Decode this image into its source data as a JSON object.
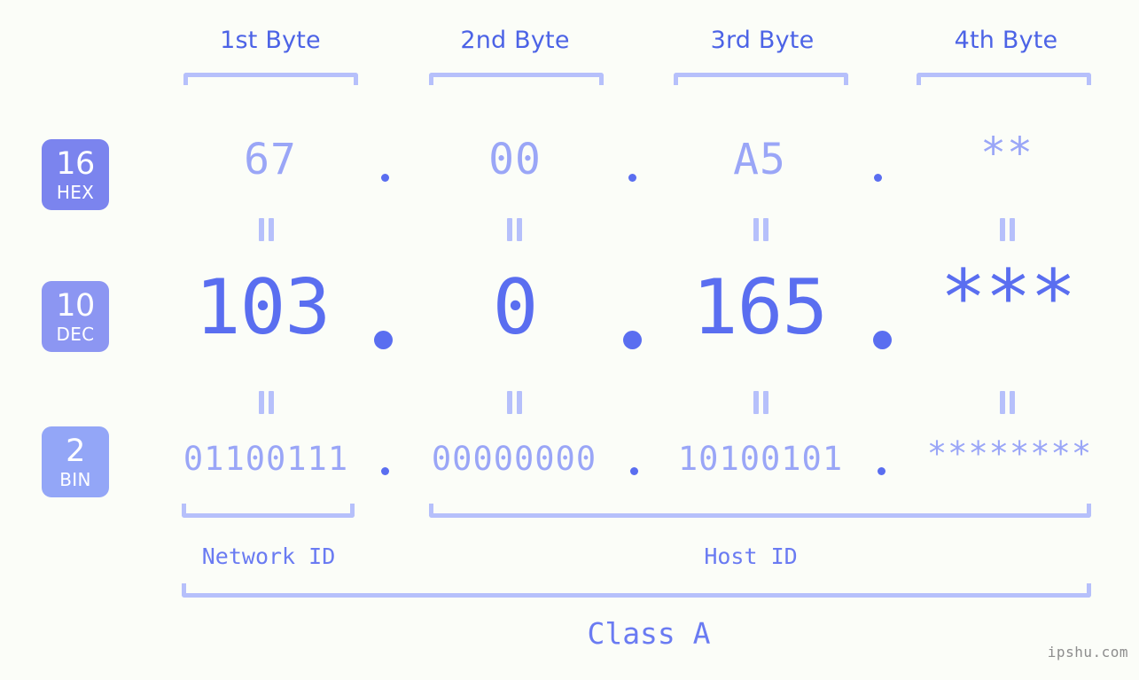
{
  "meta": {
    "watermark": "ipshu.com",
    "background_color": "#fbfdf8",
    "accent_color": "#5a6ef0",
    "light_accent_color": "#b6c0fb",
    "muted_value_color": "#9aa6f7"
  },
  "byte_headers": [
    {
      "label": "1st Byte"
    },
    {
      "label": "2nd Byte"
    },
    {
      "label": "3rd Byte"
    },
    {
      "label": "4th Byte"
    }
  ],
  "bases": [
    {
      "number": "16",
      "name": "HEX",
      "color": "#7b84ee"
    },
    {
      "number": "10",
      "name": "DEC",
      "color": "#8c96f2"
    },
    {
      "number": "2",
      "name": "BIN",
      "color": "#93a6f7"
    }
  ],
  "rows": {
    "hex": {
      "base_number": "16",
      "base_name": "HEX",
      "values": [
        "67",
        "00",
        "A5",
        "**"
      ]
    },
    "dec": {
      "base_number": "10",
      "base_name": "DEC",
      "values": [
        "103",
        "0",
        "165",
        "***"
      ]
    },
    "bin": {
      "base_number": "2",
      "base_name": "BIN",
      "values": [
        "01100111",
        "00000000",
        "10100101",
        "********"
      ]
    }
  },
  "separators": {
    "dot": ".",
    "equals": "="
  },
  "id_labels": {
    "network": "Network ID",
    "host": "Host ID"
  },
  "class_label": "Class A"
}
